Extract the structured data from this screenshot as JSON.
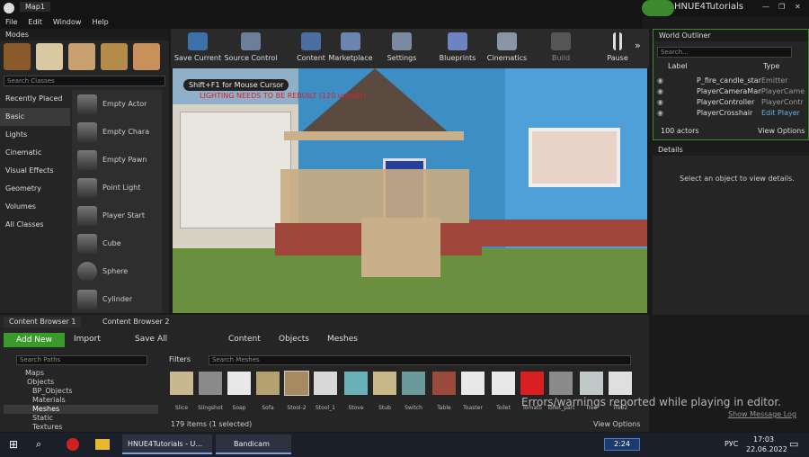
{
  "titlebar": {
    "tab": "Map1",
    "project": "HNUE4Tutorials",
    "window_buttons": [
      "—",
      "❐",
      "✕"
    ]
  },
  "menu": [
    "File",
    "Edit",
    "Window",
    "Help"
  ],
  "modes": {
    "title": "Modes",
    "search_placeholder": "Search Classes",
    "categories": [
      "Recently Placed",
      "Basic",
      "Lights",
      "Cinematic",
      "Visual Effects",
      "Geometry",
      "Volumes",
      "All Classes"
    ],
    "selected_category": "Basic",
    "items": [
      "Empty Actor",
      "Empty Chara",
      "Empty Pawn",
      "Point Light",
      "Player Start",
      "Cube",
      "Sphere",
      "Cylinder"
    ]
  },
  "toolbar": [
    "Save Current",
    "Source Control",
    "Content",
    "Marketplace",
    "Settings",
    "Blueprints",
    "Cinematics",
    "Build",
    "Pause"
  ],
  "viewport": {
    "hint": "Shift+F1 for Mouse Cursor",
    "warning": "LIGHTING NEEDS TO BE REBUILT (120 unbuilt)"
  },
  "outliner": {
    "title": "World Outliner",
    "search_placeholder": "Search...",
    "col_label": "Label",
    "col_type": "Type",
    "rows": [
      {
        "label": "P_fire_candle_stand",
        "type": "Emitter"
      },
      {
        "label": "PlayerCameraMana",
        "type": "PlayerCame"
      },
      {
        "label": "PlayerController",
        "type": "PlayerContr"
      },
      {
        "label": "PlayerCrosshair",
        "type": "Edit Player"
      }
    ],
    "count": "100 actors",
    "view_options": "View Options"
  },
  "details": {
    "title": "Details",
    "empty": "Select an object to view details."
  },
  "content_browser": {
    "tabs": [
      "Content Browser 1",
      "Content Browser 2"
    ],
    "add_new": "Add New",
    "import": "Import",
    "save_all": "Save All",
    "path": [
      "Content",
      "Objects",
      "Meshes"
    ],
    "search_paths": "Search Paths",
    "filters": "Filters",
    "search_placeholder": "Search Meshes",
    "tree": [
      "Maps",
      "Objects",
      "BP_Objects",
      "Materials",
      "Meshes",
      "Static",
      "Textures"
    ],
    "assets": [
      "Slice",
      "Slingshot",
      "Soap",
      "Sofa",
      "Stool-2",
      "Stool_1",
      "Stove",
      "Stub",
      "Switch",
      "Table",
      "Toaster",
      "Toilet",
      "Tomato",
      "Toilet_part",
      "Tree",
      "Tree2"
    ],
    "status": "179 items (1 selected)",
    "view_options": "View Options",
    "error": "Errors/warnings reported while playing in editor.",
    "show_log": "Show Message Log"
  },
  "taskbar": {
    "apps": [
      "HNUE4Tutorials - U...",
      "Bandicam"
    ],
    "record": "2:24",
    "lang": "РУС",
    "time": "17:03",
    "date": "22.06.2022"
  }
}
